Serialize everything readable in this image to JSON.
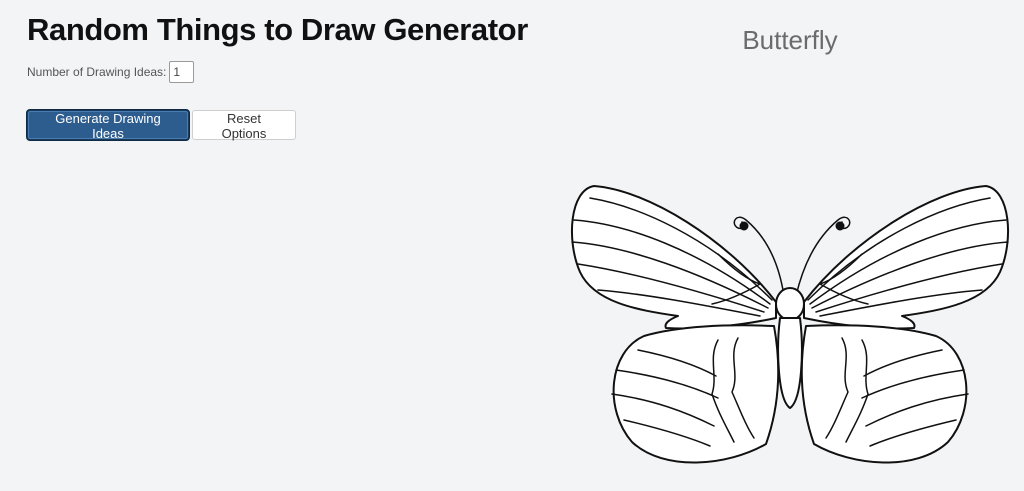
{
  "header": {
    "title": "Random Things to Draw Generator"
  },
  "options": {
    "count_label": "Number of Drawing Ideas:",
    "count_value": "1"
  },
  "actions": {
    "generate_label": "Generate Drawing Ideas",
    "reset_label": "Reset Options"
  },
  "result": {
    "idea": "Butterfly",
    "image_icon": "butterfly-illustration"
  },
  "colors": {
    "primary_button": "#2d5d8f",
    "background": "#f3f4f6"
  }
}
